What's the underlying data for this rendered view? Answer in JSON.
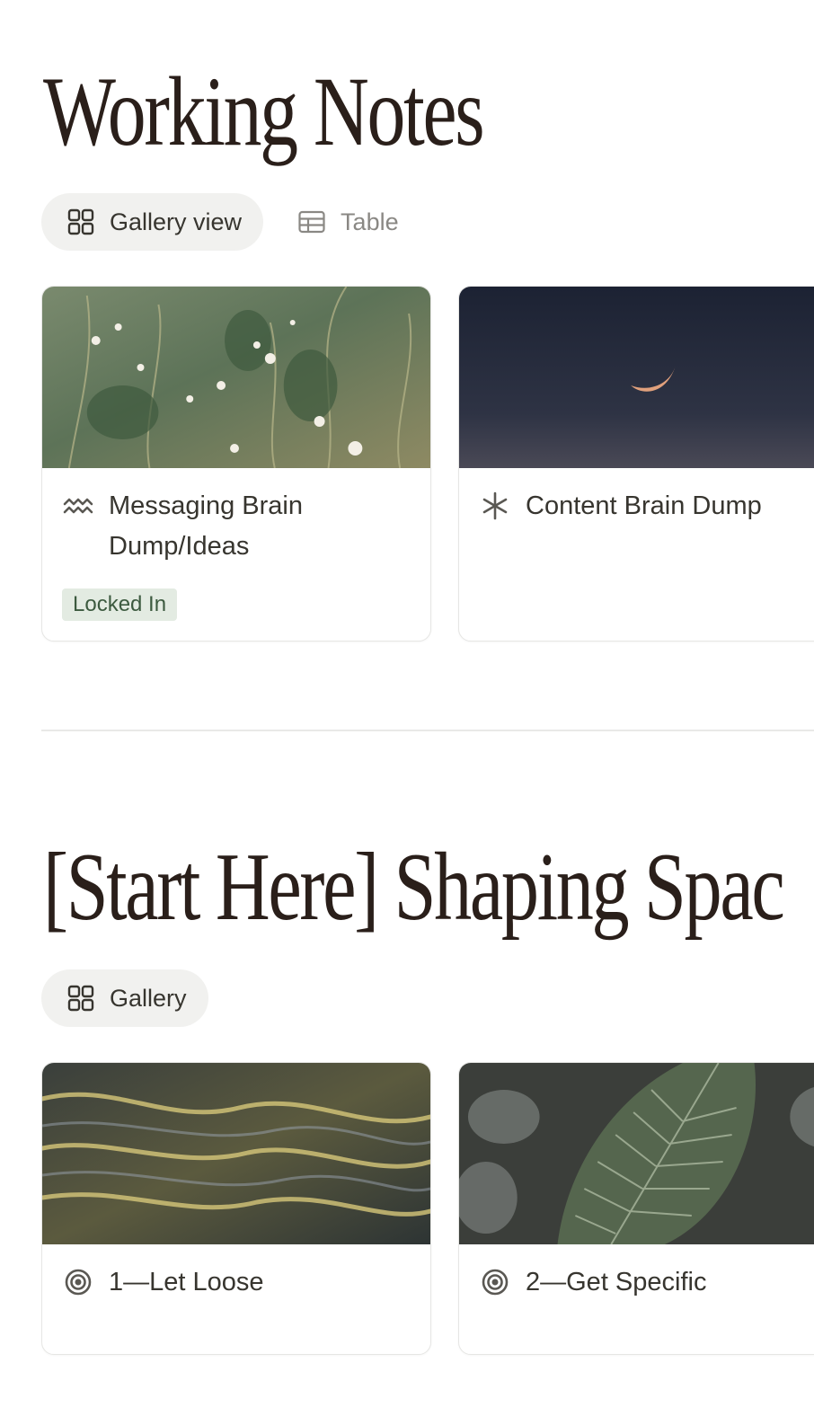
{
  "sections": [
    {
      "title": "Working Notes",
      "tabs": [
        {
          "label": "Gallery view",
          "icon": "gallery-icon",
          "active": true
        },
        {
          "label": "Table",
          "icon": "table-icon",
          "active": false
        }
      ],
      "cards": [
        {
          "title": "Messaging Brain Dump/Ideas",
          "icon": "wave-lines-icon",
          "badge": "Locked In",
          "cover": "wildflower-meadow"
        },
        {
          "title": "Content Brain Dump",
          "icon": "asterisk-icon",
          "cover": "crescent-moon-night-sky"
        }
      ]
    },
    {
      "title": "[Start Here] Shaping Spac",
      "tabs": [
        {
          "label": "Gallery",
          "icon": "gallery-icon",
          "active": true
        }
      ],
      "cards": [
        {
          "title": "1—Let Loose",
          "icon": "target-icon",
          "cover": "golden-water-ripples"
        },
        {
          "title": "2—Get Specific",
          "icon": "target-icon",
          "cover": "leaf-on-water"
        }
      ]
    }
  ],
  "colors": {
    "title": "#2a1f1a",
    "text": "#37352f",
    "tab_active_bg": "#f1f1ef",
    "badge_bg": "#e3ebe2",
    "badge_text": "#3c5a3f",
    "card_border": "#e6e6e4"
  }
}
